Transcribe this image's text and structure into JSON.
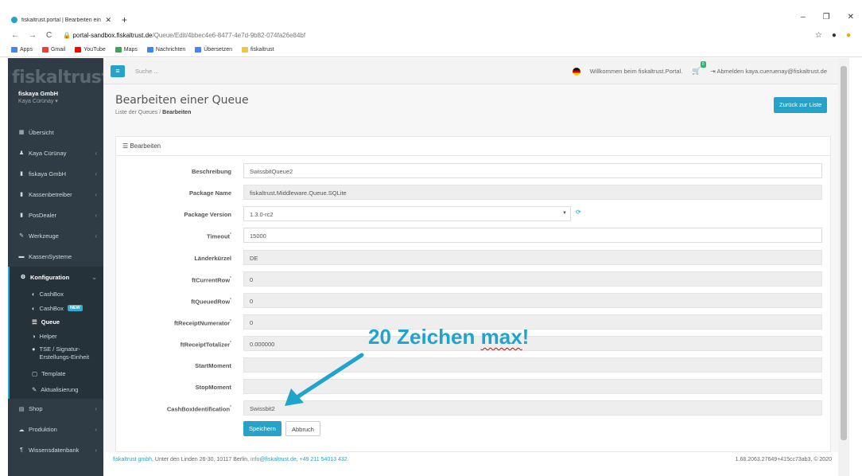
{
  "browser": {
    "tab_title": "fiskaltrust.portal | Bearbeiten ein",
    "url_domain": "portal-sandbox.fiskaltrust.de",
    "url_path": "/Queue/Edit/4bbec4e6-8477-4e7d-9b82-074fa26e84bf",
    "bookmarks": [
      "Apps",
      "Gmail",
      "YouTube",
      "Maps",
      "Nachrichten",
      "Übersetzen",
      "fiskaltrust"
    ]
  },
  "brand": "fiskaltrust.",
  "company": "fiskaya GmbH",
  "user": "Kaya Cürünay ▾",
  "nav": {
    "uebersicht": "Übersicht",
    "kaya": "Kaya Cürünay",
    "fiskaya": "fiskaya GmbH",
    "kassenbetreiber": "Kassenbetreiber",
    "posdealer": "PosDealer",
    "werkzeuge": "Werkzeuge",
    "kassensysteme": "KassenSysteme",
    "konfiguration": "Konfiguration",
    "cashbox1": "CashBox",
    "cashbox2": "CashBox",
    "new_badge": "NEW",
    "queue": "Queue",
    "helper": "Helper",
    "tse": "TSE / Signatur-Erstellungs-Einheit",
    "template": "Template",
    "aktualisierung": "Aktualisierung",
    "shop": "Shop",
    "produktion": "Produktion",
    "wissen": "Wissensdatenbank"
  },
  "topbar": {
    "search": "Suche ...",
    "welcome": "Willkommen beim fiskaltrust.Portal.",
    "cart_count": "0",
    "logout": "Abmelden kaya.cueruenay@fiskaltrust.de"
  },
  "page": {
    "title": "Bearbeiten einer Queue",
    "crumb1": "Liste der Queues",
    "crumb_sep": "/",
    "crumb2": "Bearbeiten",
    "back": "Zurück zur Liste",
    "panel_title": "Bearbeiten"
  },
  "form": {
    "beschreibung": {
      "label": "Beschreibung",
      "value": "SwissbitQueue2"
    },
    "package_name": {
      "label": "Package Name",
      "value": "fiskaltrust.Middleware.Queue.SQLite"
    },
    "package_version": {
      "label": "Package Version",
      "value": "1.3.0-rc2"
    },
    "timeout": {
      "label": "Timeout",
      "value": "15000"
    },
    "laender": {
      "label": "Länderkürzel",
      "value": "DE"
    },
    "current_row": {
      "label": "ftCurrentRow",
      "value": "0"
    },
    "queued_row": {
      "label": "ftQueuedRow",
      "value": "0"
    },
    "receipt_num": {
      "label": "ftReceiptNumerator",
      "value": "0"
    },
    "receipt_tot": {
      "label": "ftReceiptTotalizer",
      "value": "0.000000"
    },
    "start": {
      "label": "StartMoment",
      "value": ""
    },
    "stop": {
      "label": "StopMoment",
      "value": ""
    },
    "cbid": {
      "label": "CashBoxIdentification",
      "value": "Swissbit2"
    },
    "save": "Speichern",
    "cancel": "Abbruch"
  },
  "footer": {
    "company": "fiskaltrust gmbh",
    "address": ", Unter den Linden 26-30, 10117 Berlin, ",
    "email": "info@fiskaltrust.de",
    "phone": "+49 211 54013 432",
    "version": "1.68.2063.27649+415cc73ab3, © 2020"
  },
  "annotation": {
    "pre": "20 Zeichen ",
    "word": "max",
    "post": "!"
  }
}
